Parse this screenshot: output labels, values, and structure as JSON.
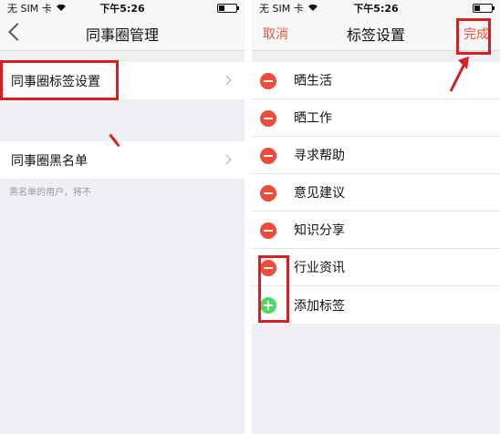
{
  "left": {
    "status": {
      "carrier": "无 SIM 卡",
      "time": "下午5:26"
    },
    "nav": {
      "title": "同事圈管理"
    },
    "cells": [
      {
        "label": "同事圈标签设置"
      },
      {
        "label": "同事圈黑名单"
      }
    ],
    "blacklist_note": "黑名单的用户，将不"
  },
  "right": {
    "status": {
      "carrier": "无 SIM 卡",
      "time": "下午5:26"
    },
    "nav": {
      "cancel": "取消",
      "title": "标签设置",
      "done": "完成"
    },
    "tags": [
      {
        "label": "晒生活"
      },
      {
        "label": "晒工作"
      },
      {
        "label": "寻求帮助"
      },
      {
        "label": "意见建议"
      },
      {
        "label": "知识分享"
      },
      {
        "label": "行业资讯"
      }
    ],
    "add_tag": "添加标签"
  },
  "colors": {
    "accent": "#e8533a",
    "delete": "#f04a3a",
    "add": "#4cd964",
    "highlight": "#d81e1e"
  }
}
